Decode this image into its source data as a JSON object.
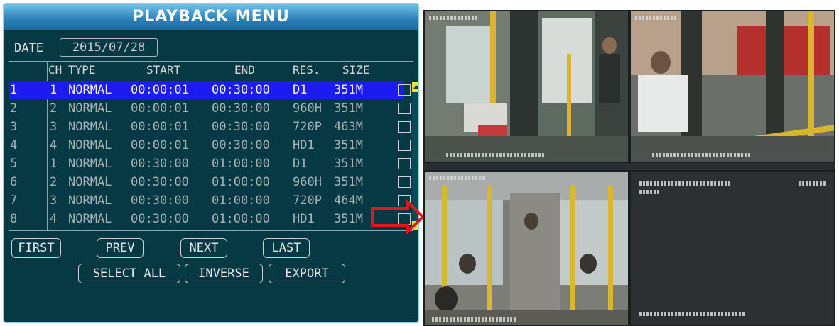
{
  "menu": {
    "title": "PLAYBACK MENU",
    "date_label": "DATE",
    "date_value": "2015/07/28"
  },
  "table": {
    "headers": {
      "ch": "CH",
      "type": "TYPE",
      "start": "START",
      "end": "END",
      "res": "RES.",
      "size": "SIZE"
    },
    "rows": [
      {
        "index": "1",
        "ch": "1",
        "type": "NORMAL",
        "start": "00:00:01",
        "end": "00:30:00",
        "res": "D1",
        "size": "351M",
        "selected": true
      },
      {
        "index": "2",
        "ch": "2",
        "type": "NORMAL",
        "start": "00:00:01",
        "end": "00:30:00",
        "res": "960H",
        "size": "351M",
        "selected": false
      },
      {
        "index": "3",
        "ch": "3",
        "type": "NORMAL",
        "start": "00:00:01",
        "end": "00:30:00",
        "res": "720P",
        "size": "463M",
        "selected": false
      },
      {
        "index": "4",
        "ch": "4",
        "type": "NORMAL",
        "start": "00:00:01",
        "end": "00:30:00",
        "res": "HD1",
        "size": "351M",
        "selected": false
      },
      {
        "index": "5",
        "ch": "1",
        "type": "NORMAL",
        "start": "00:30:00",
        "end": "01:00:00",
        "res": "D1",
        "size": "351M",
        "selected": false
      },
      {
        "index": "6",
        "ch": "2",
        "type": "NORMAL",
        "start": "00:30:00",
        "end": "01:00:00",
        "res": "960H",
        "size": "351M",
        "selected": false
      },
      {
        "index": "7",
        "ch": "3",
        "type": "NORMAL",
        "start": "00:30:00",
        "end": "01:00:00",
        "res": "720P",
        "size": "464M",
        "selected": false
      },
      {
        "index": "8",
        "ch": "4",
        "type": "NORMAL",
        "start": "00:30:00",
        "end": "01:00:00",
        "res": "HD1",
        "size": "351M",
        "selected": false
      }
    ]
  },
  "buttons": {
    "first": "FIRST",
    "prev": "PREV",
    "next": "NEXT",
    "last": "LAST",
    "select_all": "SELECT ALL",
    "inverse": "INVERSE",
    "export": "EXPORT"
  },
  "colors": {
    "panel_bg": "#063944",
    "title_bar": "#2c7fb8",
    "selected_row": "#1b1bf2",
    "arrow": "#e3161e"
  },
  "camera_views": [
    "camera-1",
    "camera-2",
    "camera-3",
    "camera-4-no-signal"
  ]
}
